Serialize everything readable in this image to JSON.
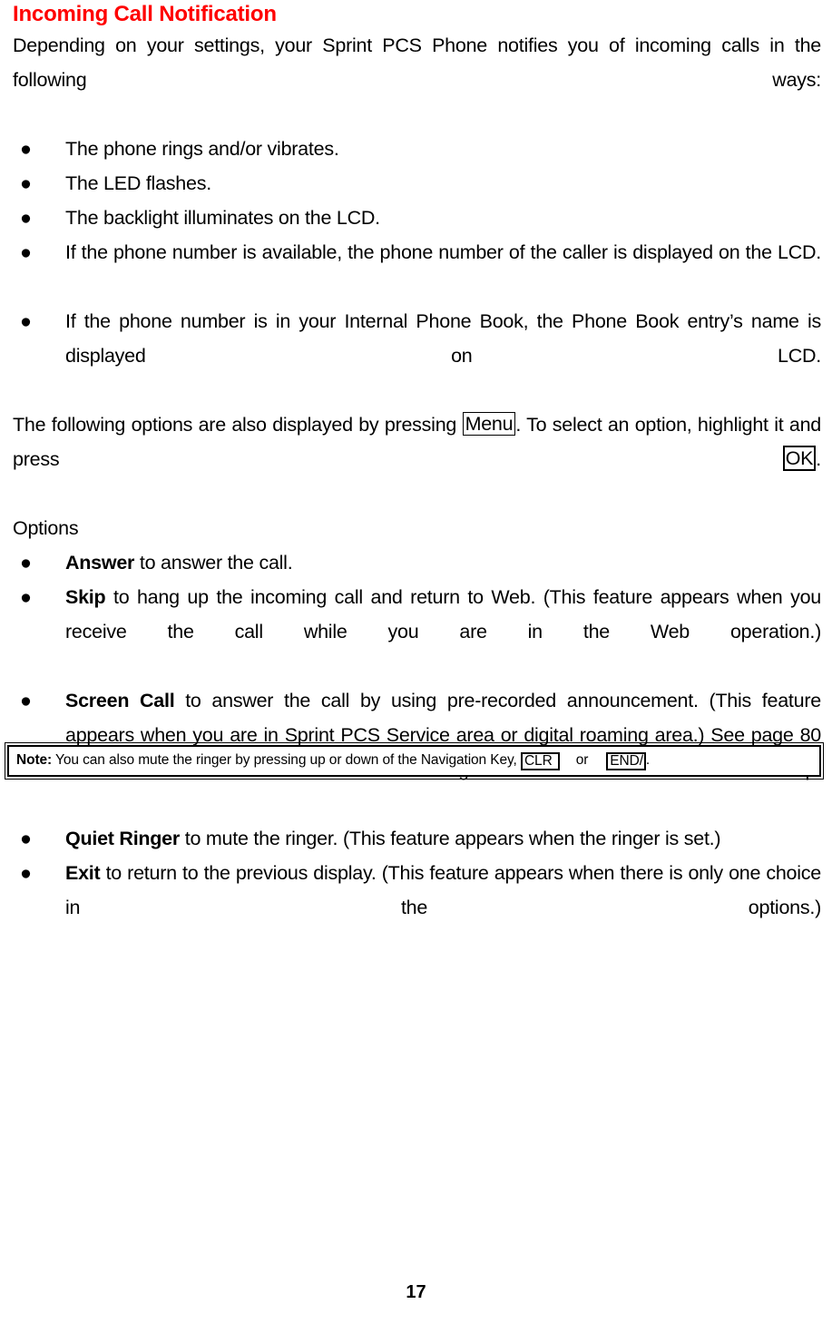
{
  "document": {
    "heading": "Incoming Call Notification",
    "heading_color": "#FF0000",
    "intro_paragraph": "Depending on your settings, your Sprint PCS Phone notifies you of incoming calls in the following ways:",
    "notification_bullets": [
      "The phone rings and/or vibrates.",
      "The LED flashes.",
      "The backlight illuminates on the LCD.",
      "If the phone number is available, the phone number of the caller is displayed on the LCD.",
      "If the phone number is in your Internal Phone Book, the Phone Book entry’s name is displayed on LCD."
    ],
    "instruction": {
      "part1": "The following options are also displayed by pressing ",
      "key1": "Menu",
      "part2": ". To select an option, highlight it and press ",
      "key2": "OK",
      "part3": "."
    },
    "options_label": "Options",
    "options": [
      {
        "name": "Answer",
        "description": " to answer the call."
      },
      {
        "name": "Skip",
        "description": " to hang up the incoming call and return to Web. (This feature appears when you receive the call while you are in the Web operation.)"
      },
      {
        "name": "Screen Call",
        "description": " to answer the call by using pre-recorded announcement. (This feature appears when you are in Sprint PCS Service area or digital roaming area.) See page 80 for setting up."
      },
      {
        "name": "Quiet Ringer",
        "description": " to mute the ringer. (This feature appears when the ringer is set.)"
      },
      {
        "name": "Exit",
        "description": " to return to the previous display. (This feature appears when there is only one choice in the options.)"
      }
    ],
    "note": {
      "label": "Note:",
      "text_before": " You can also mute the ringer by pressing up or down of the Navigation Key, ",
      "key1": "CLR",
      "conjunction": "or",
      "key2": "END/",
      "text_after": "."
    },
    "page_number": "17",
    "bullet_glyph": "●"
  }
}
